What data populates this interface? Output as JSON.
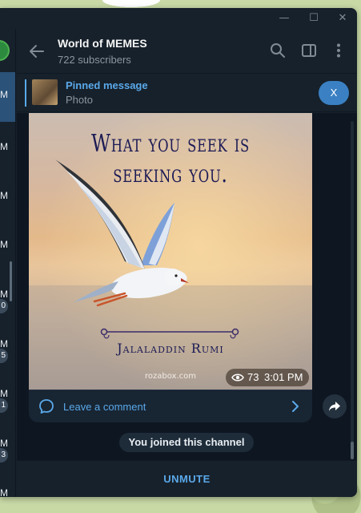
{
  "window": {
    "controls": {
      "minimize": "—",
      "maximize": "☐",
      "close": "✕"
    }
  },
  "chat_list": {
    "times": [
      "M",
      "M",
      "M",
      "M",
      "M",
      "M",
      "M",
      "M",
      "M"
    ],
    "badges": [
      "0",
      "5",
      "1",
      "3"
    ]
  },
  "header": {
    "title": "World of MEMES",
    "subtitle": "722 subscribers",
    "icons": [
      "back-arrow-icon",
      "search-icon",
      "side-panel-icon",
      "more-icon"
    ]
  },
  "pinned": {
    "title": "Pinned message",
    "subtitle": "Photo",
    "close_label": "X"
  },
  "post": {
    "quote_line1": "What you seek is",
    "quote_line2": "seeking you.",
    "author": "Jalaladdin Rumi",
    "watermark": "rozabox.com",
    "views": "73",
    "time": "3:01 PM",
    "comment_label": "Leave a comment"
  },
  "service_message": "You joined this channel",
  "bottom": {
    "unmute_label": "UNMUTE"
  },
  "colors": {
    "bg": "#17212b",
    "chat_bg": "#0e1621",
    "accent": "#5aa9ea",
    "pin_button": "#3a80c3"
  }
}
